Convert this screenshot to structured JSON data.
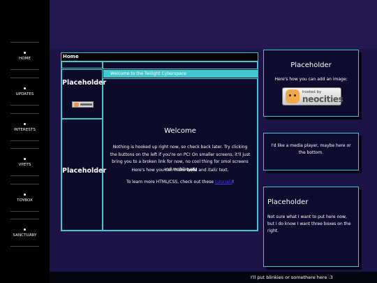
{
  "nav": {
    "items": [
      {
        "label": "HOME"
      },
      {
        "label": "UPDATES"
      },
      {
        "label": "INTERESTS"
      },
      {
        "label": "VPETS"
      },
      {
        "label": "TOYBOX"
      },
      {
        "label": "SANCTUARY"
      }
    ]
  },
  "main": {
    "home_label": "Home",
    "placeholder_top": "Placeholder",
    "placeholder_bottom": "Placeholder",
    "banner": "Welcome to the Twilight Cyberspace",
    "welcome_heading": "Welcome",
    "para1": "Nothing is hooked up right now, so check back later. Try clicking the buttons on the left if you're on PC! On smaller screens, it'll just bring you to a broken link for now, no cool thing for smol screens and mobile yet.",
    "para2_prefix": "Here's how you can make ",
    "para2_bold": "bold",
    "para2_mid": " and ",
    "para2_italic": "italic",
    "para2_suffix": " text.",
    "para3_prefix": "To learn more HTML/CSS, check out these ",
    "para3_link": "tutorials",
    "para3_suffix": "!"
  },
  "right": {
    "card1_title": "Placeholder",
    "card1_text": "Here's how you can add an image:",
    "badge_small": "hosted by",
    "badge_big": "neocities",
    "card2_text": "I'd like a media player, maybe here or the bottom.",
    "card3_title": "Placeholder",
    "card3_text": "Not sure what I want to put here now, but I do know I want three boxes on the right."
  },
  "footer": {
    "blinkies": "I'll put blinkies or somethere here :3"
  },
  "colors": {
    "accent": "#3fc9cf",
    "background": "#1c1447",
    "sidebar": "#000000",
    "link": "#3b3bff"
  }
}
